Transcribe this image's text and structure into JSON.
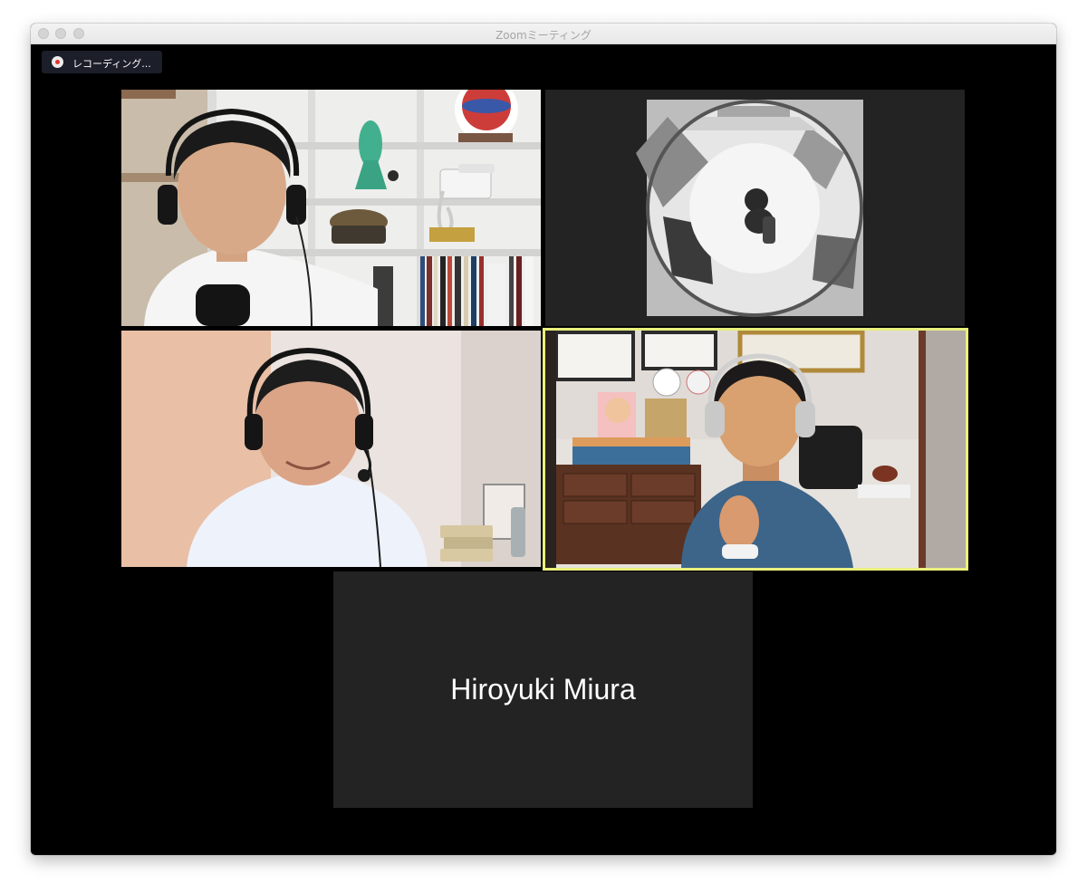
{
  "window": {
    "title": "Zoomミーティング"
  },
  "recording": {
    "label": "レコーディング..."
  },
  "participants": [
    {
      "video": "on",
      "description": "man with headset and microphone in front of shelves"
    },
    {
      "video": "on",
      "description": "fisheye overhead black and white camera"
    },
    {
      "video": "on",
      "description": "man in white shirt with headset"
    },
    {
      "video": "on",
      "active_speaker": true,
      "description": "woman with headphones at desk"
    },
    {
      "video": "off",
      "name": "Hiroyuki Miura"
    }
  ],
  "colors": {
    "active_speaker_border": "#e9ef7c",
    "background": "#000000",
    "name_tile": "#232323",
    "recording_dot": "#e0352f"
  }
}
